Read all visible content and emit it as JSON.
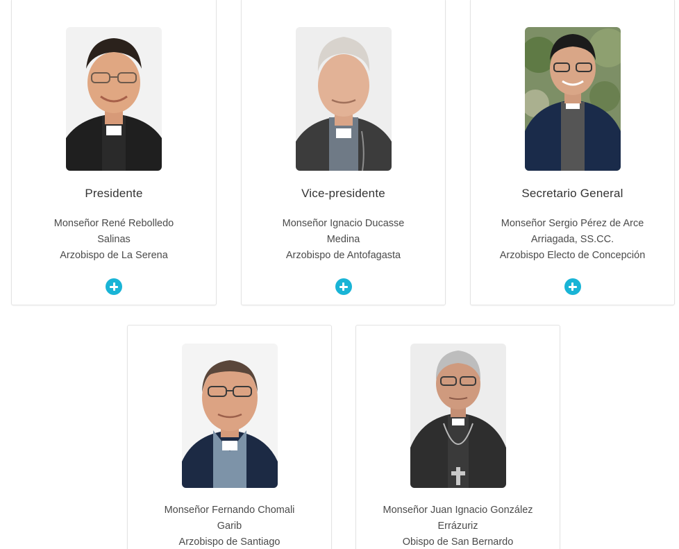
{
  "members": [
    {
      "role": "Presidente",
      "name_line1": "Monseñor René Rebolledo",
      "name_line2": "Salinas",
      "title": "Arzobispo de La Serena",
      "has_more": true
    },
    {
      "role": "Vice-presidente",
      "name_line1": "Monseñor Ignacio Ducasse",
      "name_line2": "Medina",
      "title": "Arzobispo de Antofagasta",
      "has_more": true
    },
    {
      "role": "Secretario General",
      "name_line1": "Monseñor Sergio Pérez de Arce",
      "name_line2": "Arriagada, SS.CC.",
      "title": "Arzobispo Electo de Concepción",
      "has_more": true
    },
    {
      "role": "",
      "name_line1": "Monseñor Fernando Chomali",
      "name_line2": "Garib",
      "title": "Arzobispo de Santiago",
      "has_more": false
    },
    {
      "role": "",
      "name_line1": "Monseñor Juan Ignacio González",
      "name_line2": "Errázuriz",
      "title": "Obispo de San Bernardo",
      "has_more": false
    }
  ],
  "colors": {
    "accent": "#19b4d6",
    "card_border": "#e3e3e3",
    "text_role": "#333333",
    "text_body": "#4a4a4a"
  },
  "icons": {
    "more": "plus-circle-icon"
  }
}
